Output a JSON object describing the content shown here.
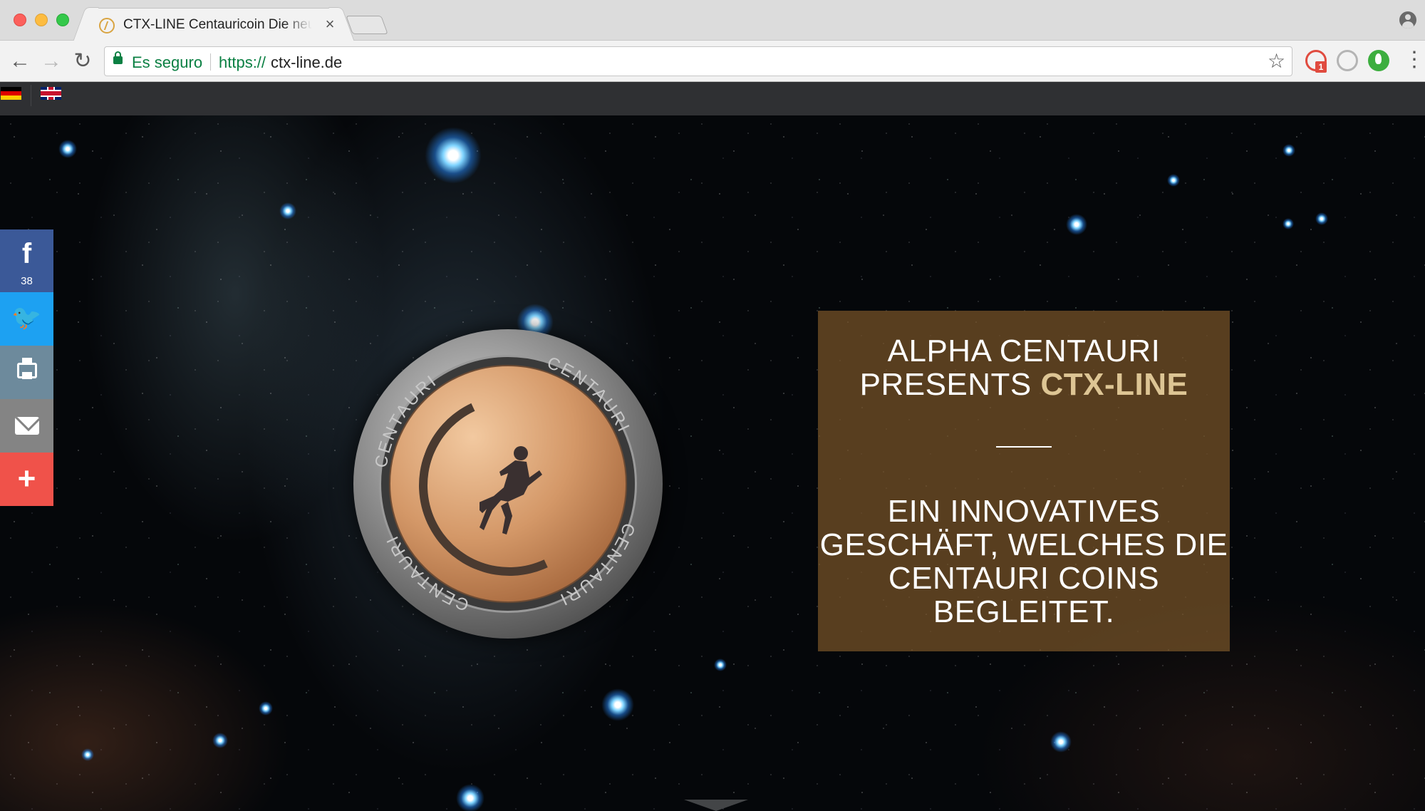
{
  "browser": {
    "tab_title": "CTX-LINE Centauricoin Die neue",
    "tab_close": "×",
    "security_label": "Es seguro",
    "url_scheme": "https://",
    "url_host": "ctx-line.de",
    "extension_badge": "1"
  },
  "site_bar": {
    "languages": [
      "de",
      "en"
    ]
  },
  "social": {
    "facebook_count": "38",
    "facebook_glyph": "f",
    "twitter_glyph": "🐦",
    "more_glyph": "+"
  },
  "coin": {
    "inscription": "CENTAURI"
  },
  "hero_panel": {
    "title_line1": "ALPHA CENTAURI",
    "title_line2_prefix": "PRESENTS ",
    "title_highlight": "CTX-LINE",
    "body": "EIN INNOVATIVES GESCHÄFT, WELCHES DIE CENTAURI COINS BEGLEITET."
  },
  "colors": {
    "panel_bg": "#785528",
    "highlight": "#ddc594",
    "facebook": "#3b5998",
    "twitter": "#1da1f2",
    "print": "#6d8a9c",
    "email": "#848484",
    "more": "#f0524a"
  }
}
